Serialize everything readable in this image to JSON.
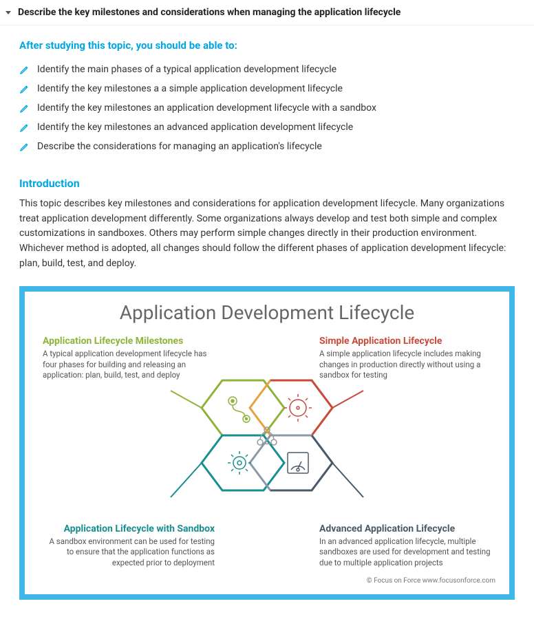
{
  "header": {
    "title": "Describe the key milestones and considerations when managing the application lifecycle"
  },
  "afterStudying": "After studying this topic, you should be able to:",
  "objectives": [
    "Identify the main phases of a typical application development lifecycle",
    "Identify the key milestones a a simple application development lifecycle",
    "Identify the key milestones an application development lifecycle with a sandbox",
    "Identify the key milestones an advanced application development lifecycle",
    "Describe the considerations for managing an application's lifecycle"
  ],
  "introHeading": "Introduction",
  "introBody": "This topic describes key milestones and considerations for application development lifecycle. Many organizations treat application development differently. Some organizations always develop and test both simple and complex customizations in sandboxes. Others may perform simple changes directly in their production environment. Whichever method is adopted, all changes should follow the different phases of application development lifecycle: plan, build, test, and deploy.",
  "diagram": {
    "title": "Application Development Lifecycle",
    "copyright": "© Focus on Force www.focusonforce.com",
    "tl": {
      "title": "Application Lifecycle Milestones",
      "body": "A typical application development lifecycle has four phases for building and releasing an application: plan, build, test, and deploy"
    },
    "tr": {
      "title": "Simple Application Lifecycle",
      "body": "A simple application lifecycle includes making changes in production directly without using a sandbox for testing"
    },
    "bl": {
      "title": "Application Lifecycle with Sandbox",
      "body": "A sandbox environment can be used for testing to ensure that the application functions as expected prior to deployment"
    },
    "br": {
      "title": "Advanced Application Lifecycle",
      "body": "In an advanced application lifecycle, multiple sandboxes are used for development and testing due to multiple application projects"
    }
  }
}
